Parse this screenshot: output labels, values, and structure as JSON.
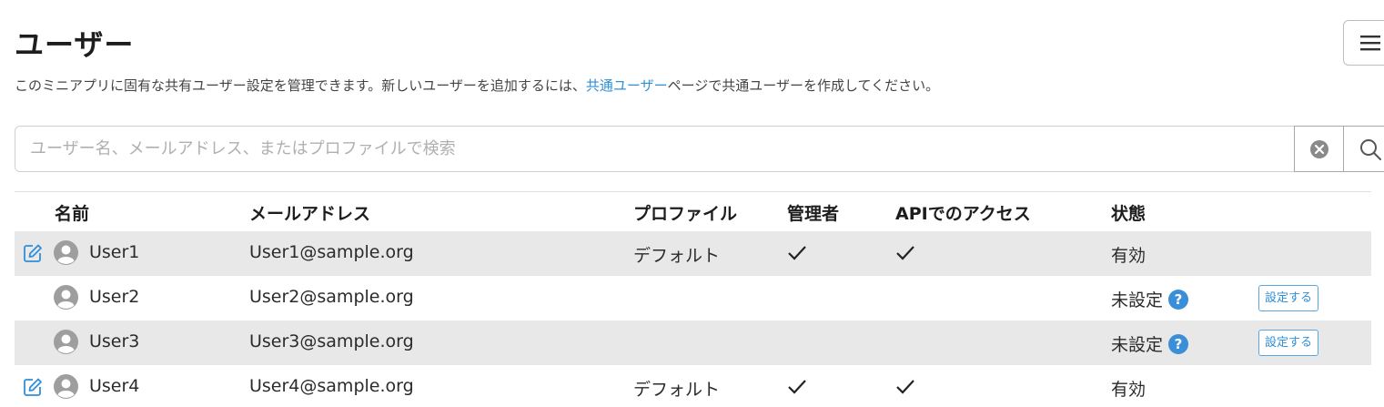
{
  "page": {
    "title": "ユーザー",
    "description_before": "このミニアプリに固有な共有ユーザー設定を管理できます。新しいユーザーを追加するには、",
    "description_link": "共通ユーザー",
    "description_after": "ページで共通ユーザーを作成してください。"
  },
  "search": {
    "placeholder": "ユーザー名、メールアドレス、またはプロファイルで検索",
    "value": ""
  },
  "table": {
    "headers": {
      "name": "名前",
      "email": "メールアドレス",
      "profile": "プロファイル",
      "admin": "管理者",
      "api_access": "APIでのアクセス",
      "status": "状態"
    },
    "rows": [
      {
        "name": "User1",
        "email": "User1@sample.org",
        "profile": "デフォルト",
        "status": "有効"
      },
      {
        "name": "User2",
        "email": "User2@sample.org",
        "profile": "",
        "status": "未設定",
        "help": "?",
        "setup_label": "設定する"
      },
      {
        "name": "User3",
        "email": "User3@sample.org",
        "profile": "",
        "status": "未設定",
        "help": "?",
        "setup_label": "設定する"
      },
      {
        "name": "User4",
        "email": "User4@sample.org",
        "profile": "デフォルト",
        "status": "有効"
      }
    ]
  },
  "icons": {
    "menu": "hamburger-menu-icon",
    "clear": "clear-circle-icon",
    "search": "search-icon",
    "edit": "edit-icon",
    "avatar": "avatar-icon",
    "check": "check-icon",
    "help": "help-icon"
  },
  "colors": {
    "accent": "#2f8fd8",
    "help_badge": "#3a8fd8",
    "row_shade": "#e8e8e8"
  }
}
